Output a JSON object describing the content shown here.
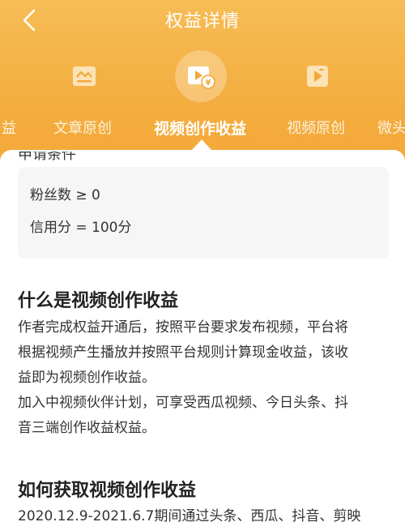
{
  "header": {
    "title": "权益详情",
    "back_icon": "chevron-left-icon"
  },
  "tabs": [
    {
      "label": "益",
      "icon": "",
      "active": false
    },
    {
      "label": "文章原创",
      "icon": "article-icon",
      "active": false
    },
    {
      "label": "视频创作收益",
      "icon": "video-yuan-icon",
      "active": true
    },
    {
      "label": "视频原创",
      "icon": "video-play-icon",
      "active": false
    },
    {
      "label": "微头",
      "icon": "",
      "active": false
    }
  ],
  "partial_heading": "申请条件",
  "conditions": [
    "粉丝数 ≥ 0",
    "信用分 = 100分"
  ],
  "section1": {
    "title": "什么是视频创作收益",
    "lines": [
      "作者完成权益开通后，按照平台要求发布视频，平台将",
      "根据视频产生播放并按照平台规则计算现金收益，该收",
      "益即为视频创作收益。",
      "加入中视频伙伴计划，可享受西瓜视频、今日头条、抖",
      "音三端创作收益权益。"
    ]
  },
  "section2": {
    "title": "如何获取视频创作收益",
    "lines": [
      "2020.12.9-2021.6.7期间通过头条、西瓜、抖音、剪映"
    ]
  },
  "colors": {
    "header_top": "#f6bd56",
    "header_bottom": "#f3a838",
    "text": "#333333"
  }
}
